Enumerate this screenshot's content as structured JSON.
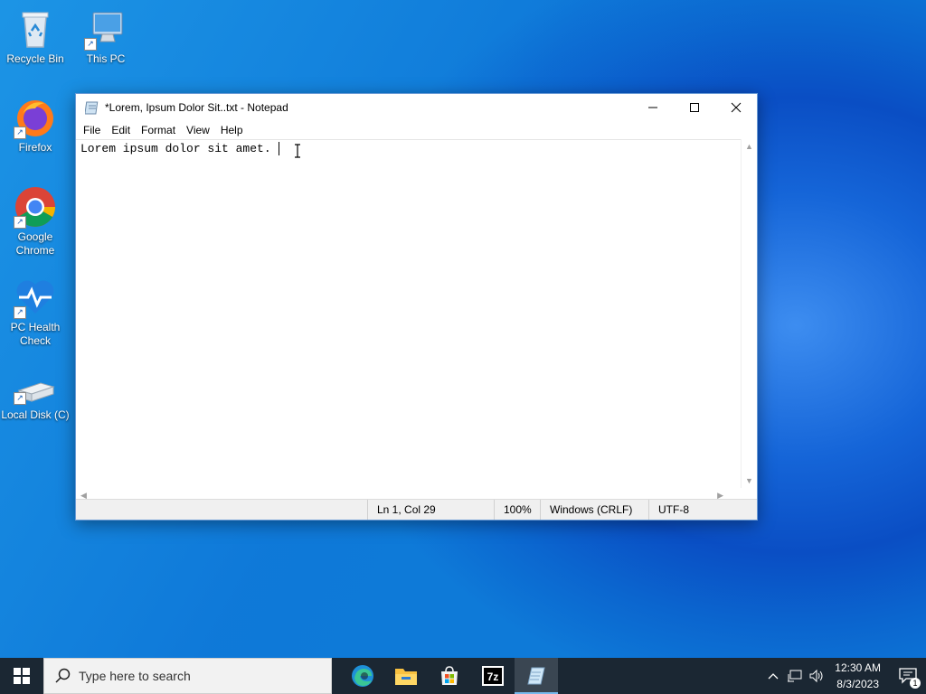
{
  "desktop": {
    "icons": [
      {
        "label": "Recycle Bin"
      },
      {
        "label": "This PC"
      },
      {
        "label": "Firefox"
      },
      {
        "label": "Google Chrome"
      },
      {
        "label": "PC Health Check"
      },
      {
        "label": "Local Disk (C)"
      }
    ]
  },
  "notepad": {
    "title": "*Lorem, Ipsum Dolor Sit..txt - Notepad",
    "menu": [
      "File",
      "Edit",
      "Format",
      "View",
      "Help"
    ],
    "content": "Lorem ipsum dolor sit amet. ",
    "status": {
      "position": "Ln 1, Col 29",
      "zoom": "100%",
      "line_ending": "Windows (CRLF)",
      "encoding": "UTF-8"
    }
  },
  "taskbar": {
    "search_placeholder": "Type here to search",
    "apps": [
      "edge-icon",
      "file-explorer-icon",
      "microsoft-store-icon",
      "7zip-icon",
      "notepad-icon"
    ],
    "clock_time": "12:30 AM",
    "clock_date": "8/3/2023",
    "notification_count": "1"
  }
}
